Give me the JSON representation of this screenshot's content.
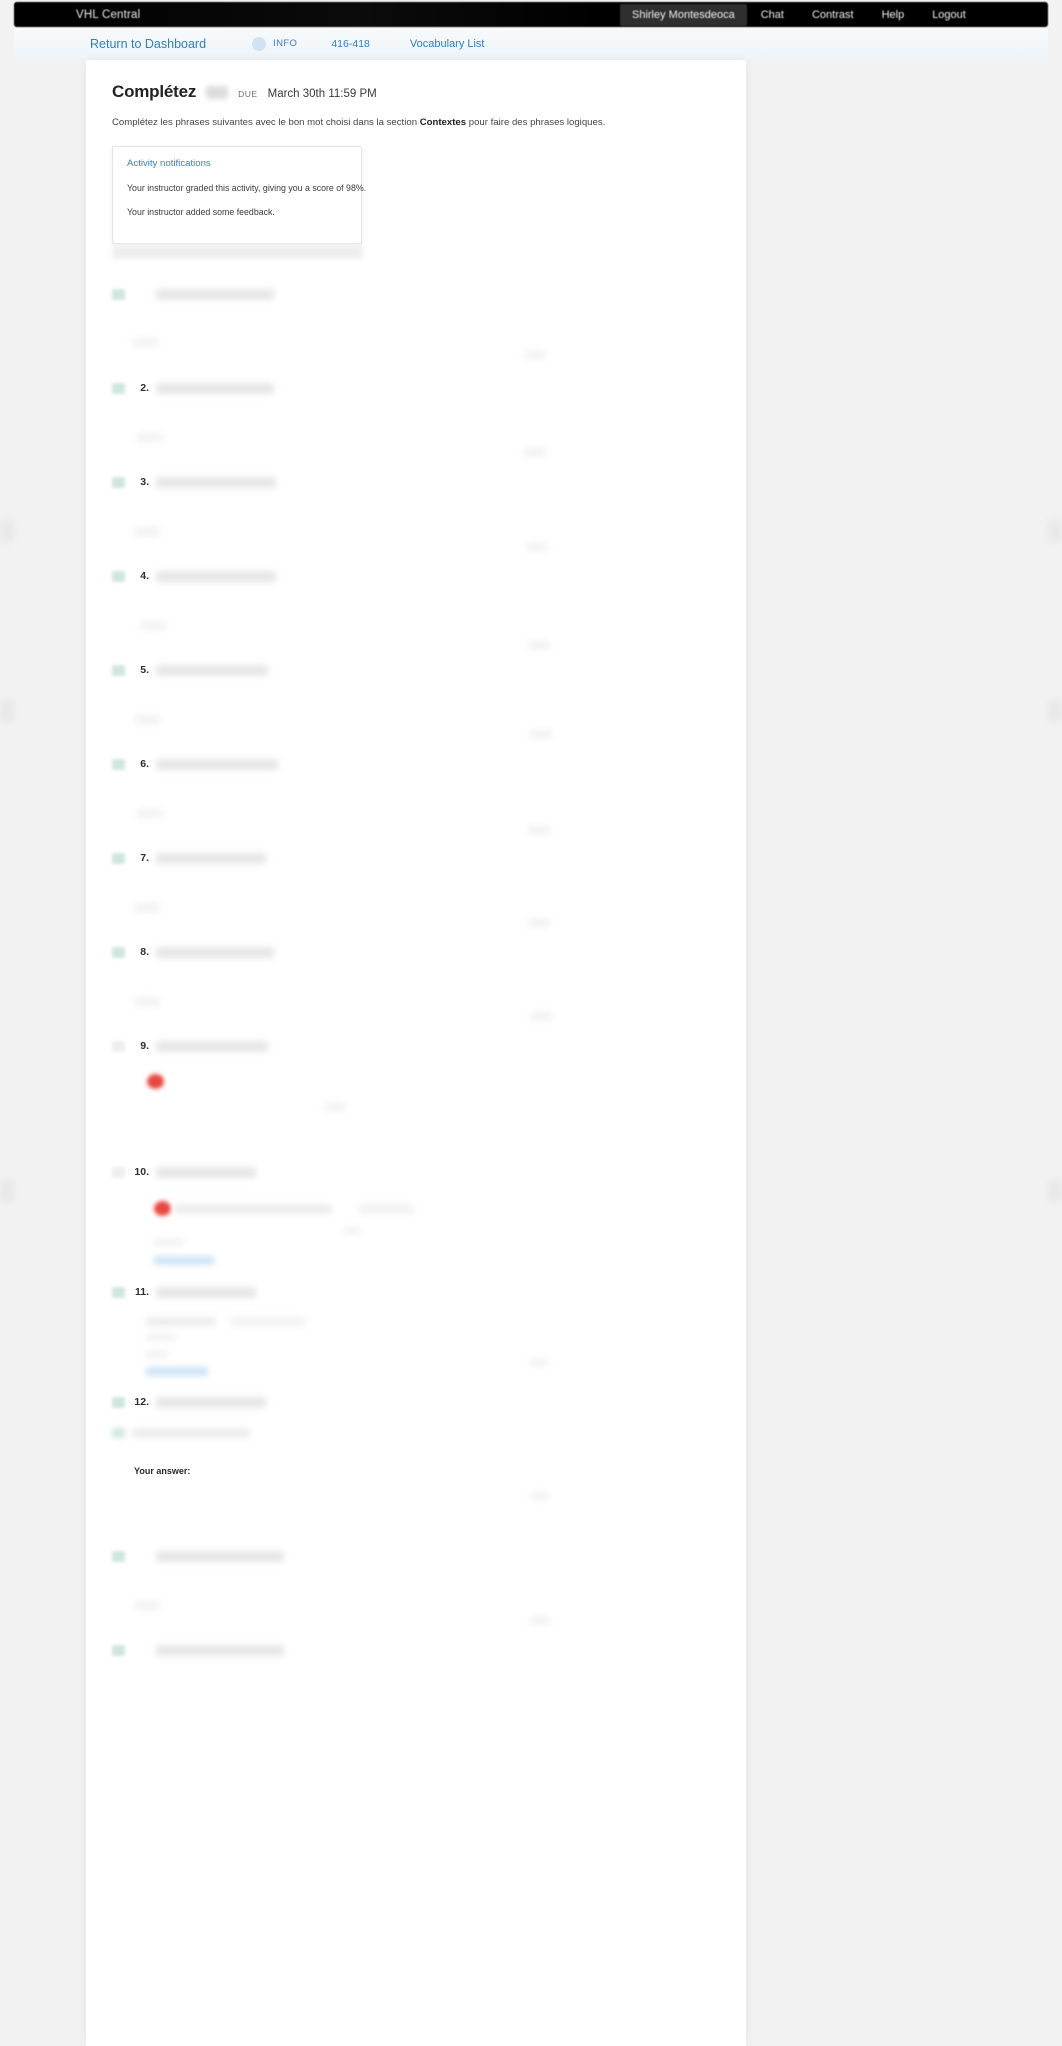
{
  "header": {
    "brand": "VHL Central",
    "user": "Shirley Montesdeoca",
    "links": [
      "Chat",
      "Contrast",
      "Help",
      "Logout"
    ],
    "chat_label": "Chat",
    "contrast_label": "Contrast",
    "help_label": "Help",
    "logout_label": "Logout"
  },
  "subnav": {
    "return_label": "Return to Dashboard",
    "info_label": "INFO",
    "course_code": "416-418",
    "vocabulary_label": "Vocabulary List"
  },
  "activity": {
    "title": "Complétez",
    "due_label": "DUE",
    "due_date": "March 30th 11:59 PM",
    "instructions_pre": "Complétez les phrases suivantes avec le bon mot choisi dans la section ",
    "instructions_bold": "Contextes",
    "instructions_post": " pour faire des phrases logiques."
  },
  "notifications": {
    "title": "Activity notifications",
    "lines": [
      "Your instructor graded this activity, giving you a score of 98%.",
      "Your instructor added some feedback."
    ],
    "score": "98%"
  },
  "questions": [
    {
      "number": "",
      "has_badge": true
    },
    {
      "number": "2.",
      "has_badge": true
    },
    {
      "number": "3.",
      "has_badge": true
    },
    {
      "number": "4.",
      "has_badge": true
    },
    {
      "number": "5.",
      "has_badge": true
    },
    {
      "number": "6.",
      "has_badge": true
    },
    {
      "number": "7.",
      "has_badge": true
    },
    {
      "number": "8.",
      "has_badge": true
    },
    {
      "number": "9.",
      "has_badge": false
    },
    {
      "number": "10.",
      "has_badge": false
    },
    {
      "number": "11.",
      "has_badge": true
    },
    {
      "number": "12.",
      "has_badge": true
    }
  ],
  "answer_label": "Your answer:",
  "colors": {
    "header_bg": "#000000",
    "link_blue": "#2f7fc4",
    "notif_blue": "#3286c4",
    "correct_badge": "#cfe6dd",
    "incorrect_marker": "#e8473f",
    "page_bg": "#f2f2f2",
    "sheet_bg": "#ffffff"
  }
}
